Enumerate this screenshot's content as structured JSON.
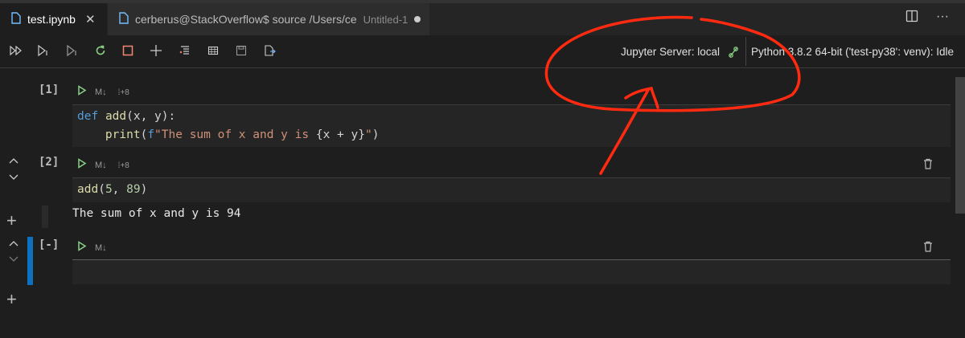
{
  "tabs": [
    {
      "label": "test.ipynb",
      "active": true
    },
    {
      "label": "cerberus@StackOverflow$ source /Users/ce",
      "subtitle": "Untitled-1",
      "modified": true
    }
  ],
  "window_icons": [
    "split-editor-icon",
    "more-icon"
  ],
  "toolbar": {
    "icons": [
      "run-all-icon",
      "run-above-icon",
      "run-below-icon",
      "restart-kernel-icon",
      "interrupt-icon",
      "add-cell-icon",
      "clear-outputs-icon",
      "variables-icon",
      "save-icon",
      "export-icon"
    ],
    "server_label": "Jupyter Server: local",
    "kernel_label": "Python 3.8.2 64-bit ('test-py38': venv): Idle"
  },
  "cells": [
    {
      "exec_count": "[1]",
      "type_label": "M↓",
      "code_lines": [
        "def add(x, y):",
        "    print(f\"The sum of x and y is {x + y}\")"
      ]
    },
    {
      "exec_count": "[2]",
      "type_label": "M↓",
      "code_lines": [
        "add(5, 89)"
      ],
      "output": "The sum of x and y is 94"
    },
    {
      "exec_count": "[-]",
      "type_label": "M↓",
      "code_lines": [
        ""
      ]
    }
  ],
  "annotation": {
    "color": "#ff2a10"
  },
  "colors": {
    "accent": "#0e70c0",
    "run": "#89d185",
    "restart": "#89d185",
    "interrupt": "#f48771"
  }
}
